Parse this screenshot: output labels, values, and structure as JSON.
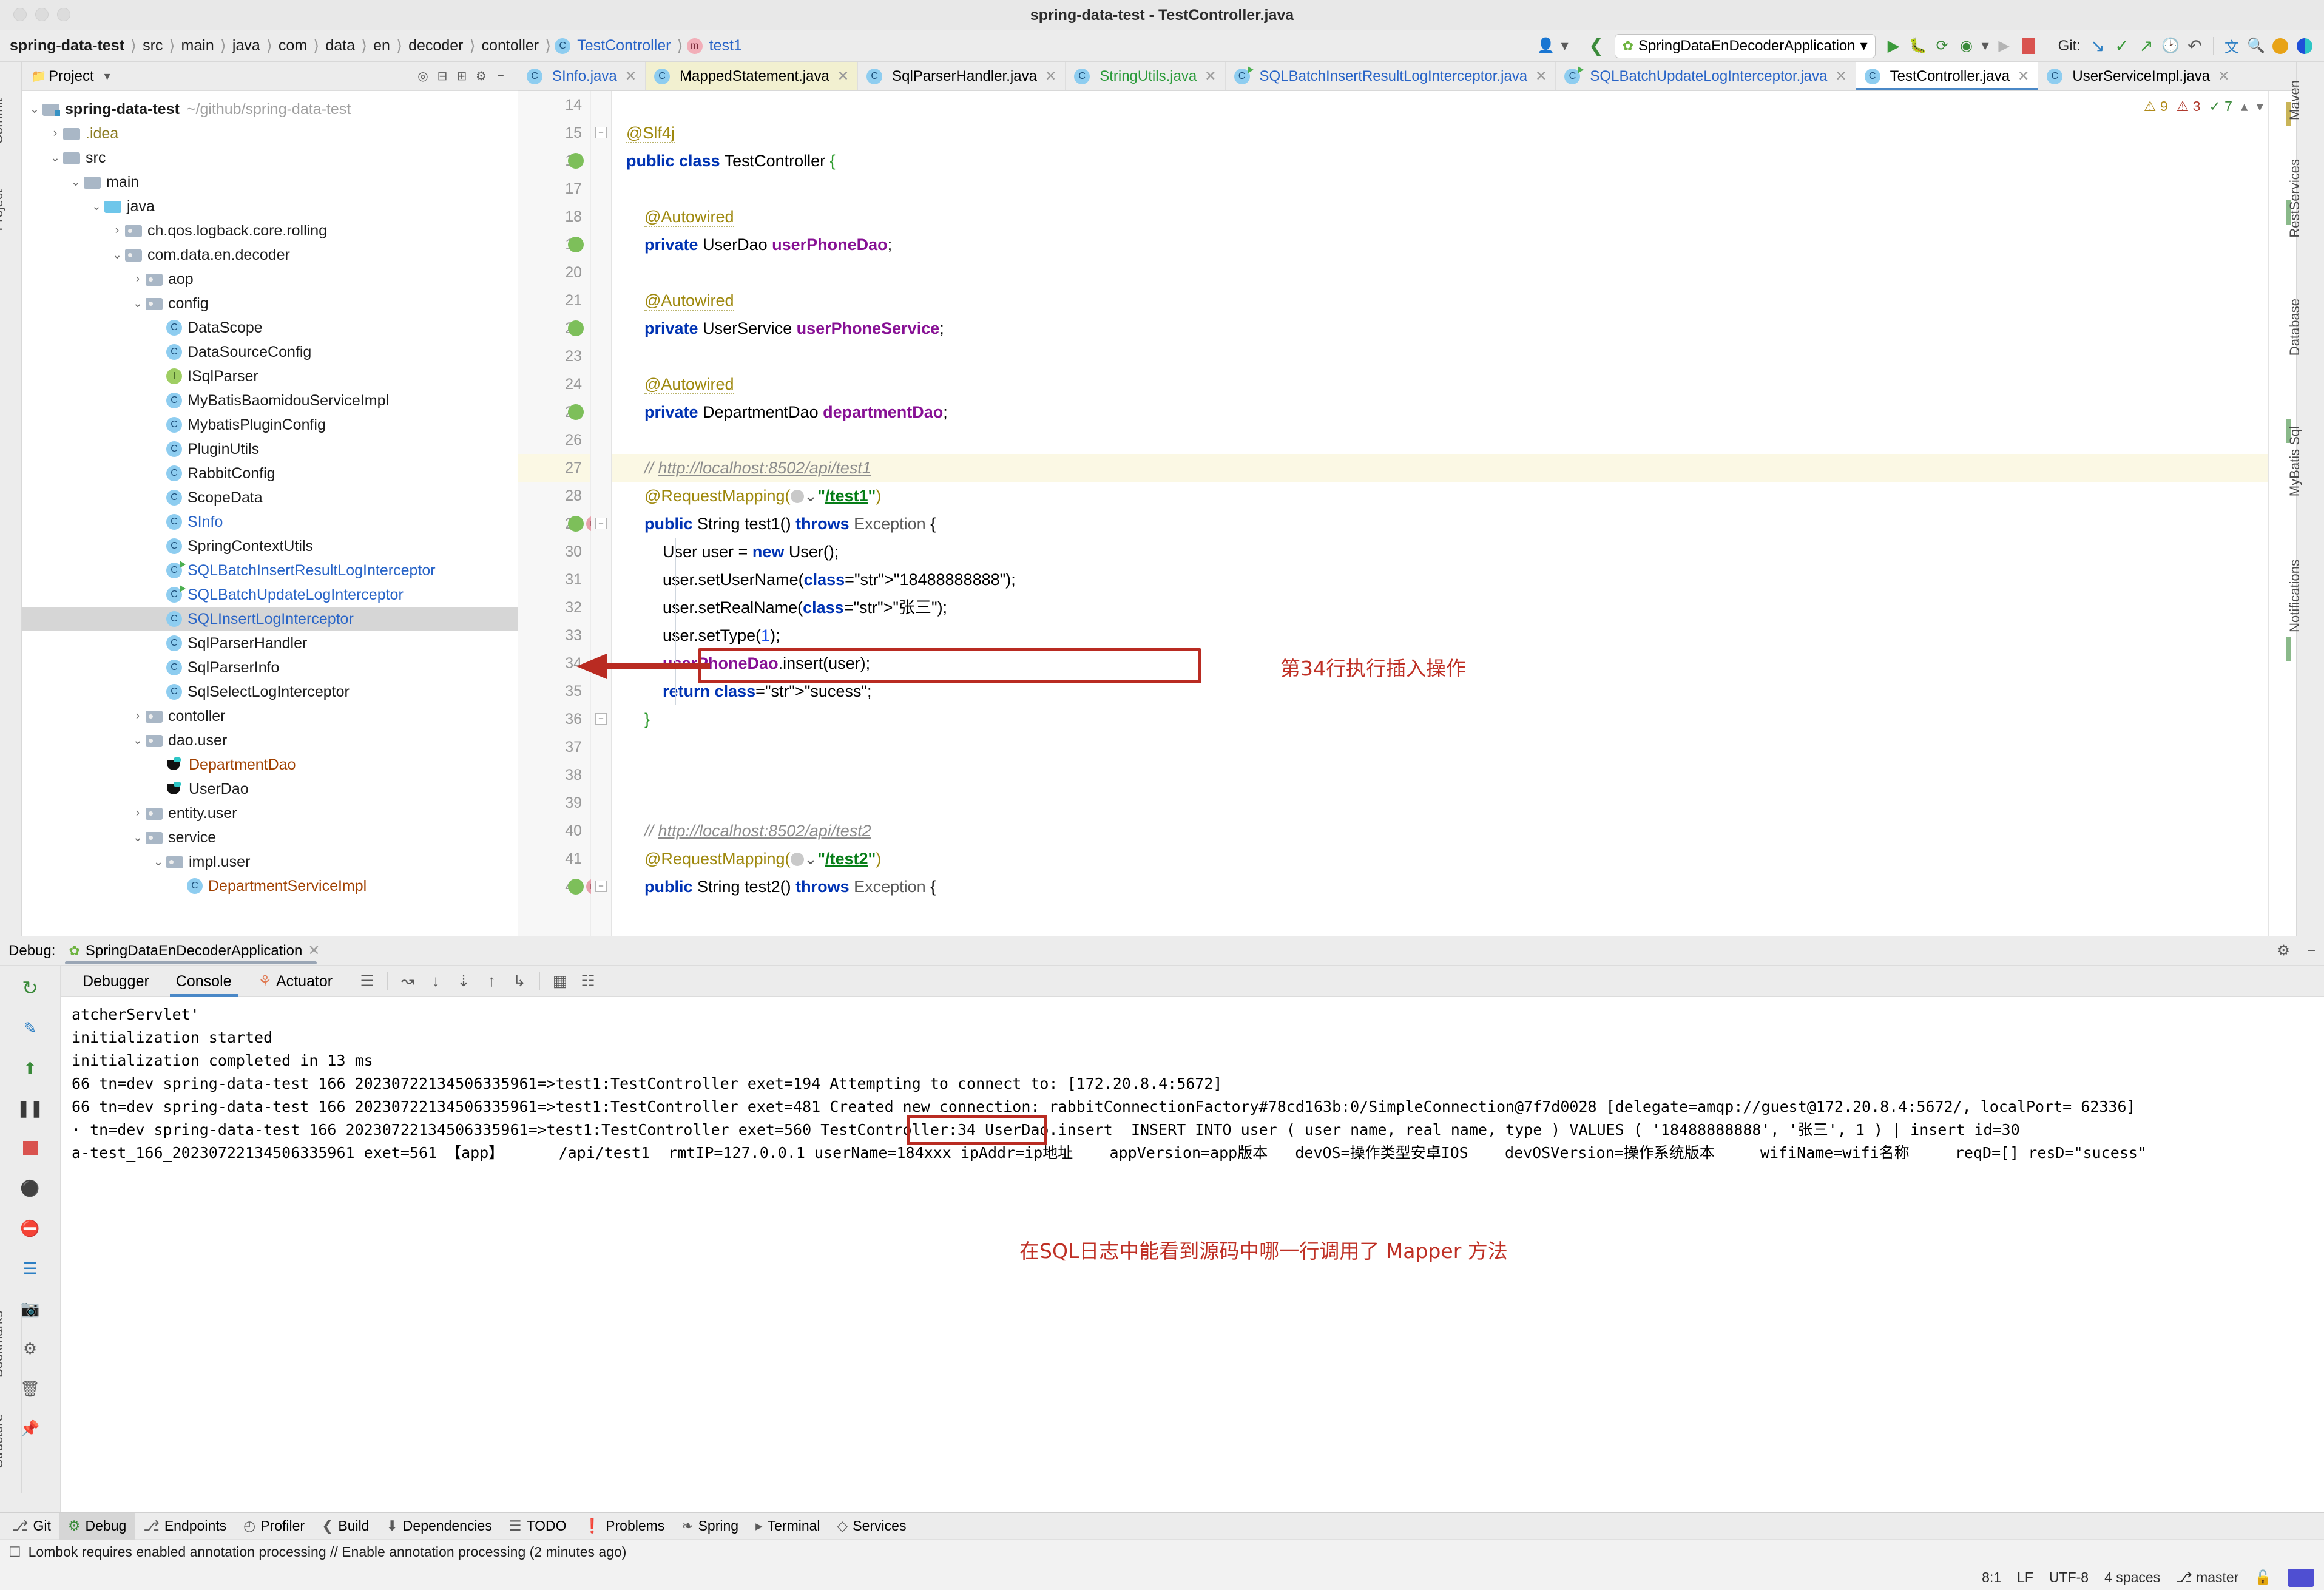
{
  "window": {
    "title": "spring-data-test - TestController.java"
  },
  "breadcrumb": {
    "items": [
      "spring-data-test",
      "src",
      "main",
      "java",
      "com",
      "data",
      "en",
      "decoder",
      "contoller"
    ],
    "class_name": "TestController",
    "method_name": "test1"
  },
  "toolbar": {
    "run_config": "SpringDataEnDecoderApplication",
    "git_label": "Git:",
    "icons": [
      "user-avatar-icon",
      "chevron-down-icon",
      "back-arrow-icon",
      "run-icon",
      "debug-icon",
      "run-with-coverage-icon",
      "profiler-icon",
      "chevron-down-icon",
      "run-disabled-icon",
      "stop-icon",
      "git-update-icon",
      "git-commit-icon",
      "git-push-icon",
      "git-history-icon",
      "git-rollback-icon",
      "translate-icon",
      "search-everywhere-icon",
      "notification-icon",
      "theme-icon"
    ]
  },
  "project_panel": {
    "header": "Project",
    "header_icons": [
      "select-opened-file-icon",
      "collapse-all-icon",
      "expand-icon",
      "settings-gear-icon",
      "hide-icon"
    ],
    "tree": [
      {
        "indent": 0,
        "arrow": "v",
        "icon": "module-folder",
        "label": "spring-data-test",
        "bold": true,
        "path": "~/github/spring-data-test"
      },
      {
        "indent": 1,
        "arrow": ">",
        "icon": "folder",
        "label": ".idea",
        "color": "olive"
      },
      {
        "indent": 1,
        "arrow": "v",
        "icon": "folder",
        "label": "src"
      },
      {
        "indent": 2,
        "arrow": "v",
        "icon": "folder",
        "label": "main"
      },
      {
        "indent": 3,
        "arrow": "v",
        "icon": "folder-blue",
        "label": "java"
      },
      {
        "indent": 4,
        "arrow": ">",
        "icon": "package",
        "label": "ch.qos.logback.core.rolling"
      },
      {
        "indent": 4,
        "arrow": "v",
        "icon": "package",
        "label": "com.data.en.decoder"
      },
      {
        "indent": 5,
        "arrow": ">",
        "icon": "package",
        "label": "aop"
      },
      {
        "indent": 5,
        "arrow": "v",
        "icon": "package",
        "label": "config"
      },
      {
        "indent": 6,
        "arrow": "",
        "icon": "class",
        "label": "DataScope"
      },
      {
        "indent": 6,
        "arrow": "",
        "icon": "class",
        "label": "DataSourceConfig"
      },
      {
        "indent": 6,
        "arrow": "",
        "icon": "interface",
        "label": "ISqlParser"
      },
      {
        "indent": 6,
        "arrow": "",
        "icon": "class",
        "label": "MyBatisBaomidouServiceImpl"
      },
      {
        "indent": 6,
        "arrow": "",
        "icon": "class",
        "label": "MybatisPluginConfig"
      },
      {
        "indent": 6,
        "arrow": "",
        "icon": "class",
        "label": "PluginUtils"
      },
      {
        "indent": 6,
        "arrow": "",
        "icon": "class",
        "label": "RabbitConfig"
      },
      {
        "indent": 6,
        "arrow": "",
        "icon": "class",
        "label": "ScopeData"
      },
      {
        "indent": 6,
        "arrow": "",
        "icon": "class",
        "label": "SInfo",
        "color": "blue"
      },
      {
        "indent": 6,
        "arrow": "",
        "icon": "class",
        "label": "SpringContextUtils"
      },
      {
        "indent": 6,
        "arrow": "",
        "icon": "class-runnable",
        "label": "SQLBatchInsertResultLogInterceptor",
        "color": "blue"
      },
      {
        "indent": 6,
        "arrow": "",
        "icon": "class-runnable",
        "label": "SQLBatchUpdateLogInterceptor",
        "color": "blue"
      },
      {
        "indent": 6,
        "arrow": "",
        "icon": "class",
        "label": "SQLInsertLogInterceptor",
        "color": "blue",
        "selected": true
      },
      {
        "indent": 6,
        "arrow": "",
        "icon": "class",
        "label": "SqlParserHandler"
      },
      {
        "indent": 6,
        "arrow": "",
        "icon": "class",
        "label": "SqlParserInfo"
      },
      {
        "indent": 6,
        "arrow": "",
        "icon": "class",
        "label": "SqlSelectLogInterceptor"
      },
      {
        "indent": 5,
        "arrow": ">",
        "icon": "package",
        "label": "contoller"
      },
      {
        "indent": 5,
        "arrow": "v",
        "icon": "package",
        "label": "dao.user"
      },
      {
        "indent": 6,
        "arrow": "",
        "icon": "mybatis",
        "label": "DepartmentDao",
        "color": "brown"
      },
      {
        "indent": 6,
        "arrow": "",
        "icon": "mybatis",
        "label": "UserDao"
      },
      {
        "indent": 5,
        "arrow": ">",
        "icon": "package",
        "label": "entity.user"
      },
      {
        "indent": 5,
        "arrow": "v",
        "icon": "package",
        "label": "service"
      },
      {
        "indent": 6,
        "arrow": "v",
        "icon": "package",
        "label": "impl.user"
      },
      {
        "indent": 7,
        "arrow": "",
        "icon": "class",
        "label": "DepartmentServiceImpl",
        "color": "brown"
      }
    ]
  },
  "editor": {
    "tabs": [
      {
        "label": "SInfo.java",
        "icon": "class-icon",
        "color": "blue"
      },
      {
        "label": "MappedStatement.java",
        "icon": "class-icon",
        "color": "black",
        "highlighted": true
      },
      {
        "label": "SqlParserHandler.java",
        "icon": "class-icon",
        "color": "black"
      },
      {
        "label": "StringUtils.java",
        "icon": "class-icon",
        "color": "green"
      },
      {
        "label": "SQLBatchInsertResultLogInterceptor.java",
        "icon": "class-runnable-icon",
        "color": "blue"
      },
      {
        "label": "SQLBatchUpdateLogInterceptor.java",
        "icon": "class-runnable-icon",
        "color": "blue"
      },
      {
        "label": "TestController.java",
        "icon": "class-icon",
        "color": "black",
        "active": true
      },
      {
        "label": "UserServiceImpl.java",
        "icon": "class-icon",
        "color": "black"
      }
    ],
    "inspection": {
      "warnings": "9",
      "errors": "3",
      "weak": "7"
    },
    "first_line_number": 14,
    "lines": [
      {
        "n": 14,
        "text": ""
      },
      {
        "n": 15,
        "text": "@Slf4j"
      },
      {
        "n": 16,
        "text": "public class TestController {"
      },
      {
        "n": 17,
        "text": ""
      },
      {
        "n": 18,
        "text": "    @Autowired"
      },
      {
        "n": 19,
        "text": "    private UserDao userPhoneDao;"
      },
      {
        "n": 20,
        "text": ""
      },
      {
        "n": 21,
        "text": "    @Autowired"
      },
      {
        "n": 22,
        "text": "    private UserService userPhoneService;"
      },
      {
        "n": 23,
        "text": ""
      },
      {
        "n": 24,
        "text": "    @Autowired"
      },
      {
        "n": 25,
        "text": "    private DepartmentDao departmentDao;"
      },
      {
        "n": 26,
        "text": ""
      },
      {
        "n": 27,
        "text": "    // http://localhost:8502/api/test1"
      },
      {
        "n": 28,
        "text": "    @RequestMapping(\"/test1\")"
      },
      {
        "n": 29,
        "text": "    public String test1() throws Exception {"
      },
      {
        "n": 30,
        "text": "        User user = new User();"
      },
      {
        "n": 31,
        "text": "        user.setUserName(\"18488888888\");"
      },
      {
        "n": 32,
        "text": "        user.setRealName(\"张三\");"
      },
      {
        "n": 33,
        "text": "        user.setType(1);"
      },
      {
        "n": 34,
        "text": "        userPhoneDao.insert(user);"
      },
      {
        "n": 35,
        "text": "        return \"sucess\";"
      },
      {
        "n": 36,
        "text": "    }"
      },
      {
        "n": 37,
        "text": ""
      },
      {
        "n": 38,
        "text": ""
      },
      {
        "n": 39,
        "text": ""
      },
      {
        "n": 40,
        "text": "    // http://localhost:8502/api/test2"
      },
      {
        "n": 41,
        "text": "    @RequestMapping(\"/test2\")"
      },
      {
        "n": 42,
        "text": "    public String test2() throws Exception {"
      }
    ]
  },
  "annotations": {
    "code_note": "第34行执行插入操作",
    "log_note": "在SQL日志中能看到源码中哪一行调用了 Mapper 方法",
    "accent_color": "#bf3025"
  },
  "debug": {
    "label": "Debug:",
    "session": "SpringDataEnDecoderApplication",
    "tabs": [
      {
        "label": "Debugger"
      },
      {
        "label": "Console",
        "active": true
      },
      {
        "label": "Actuator",
        "icon": "actuator-icon"
      }
    ],
    "side_icons": [
      "rerun-icon",
      "edit-icon",
      "resume-icon",
      "pause-icon",
      "stop-icon",
      "mute-breakpoints-icon",
      "view-breakpoints-icon",
      "settings-icon",
      "camera-icon",
      "print-icon",
      "trash-icon",
      "pin-icon"
    ],
    "toolbar_icons": [
      "soft-wrap-icon",
      "step-over-icon",
      "step-into-icon",
      "force-step-into-icon",
      "step-out-icon",
      "run-to-cursor-icon",
      "evaluate-icon",
      "layout-icon"
    ],
    "console_lines": [
      "atcherServlet'",
      "initialization started",
      "initialization completed in 13 ms",
      "66 tn=dev_spring-data-test_166_20230722134506335961=>test1:TestController exet=194 Attempting to connect to: [172.20.8.4:5672]",
      "66 tn=dev_spring-data-test_166_20230722134506335961=>test1:TestController exet=481 Created new connection: rabbitConnectionFactory#78cd163b:0/SimpleConnection@7f7d0028 [delegate=amqp://guest@172.20.8.4:5672/, localPort= 62336]",
      "· tn=dev_spring-data-test_166_20230722134506335961=>test1:TestController exet=560 TestController:34 UserDao.insert  INSERT INTO user ( user_name, real_name, type ) VALUES ( '18488888888', '张三', 1 ) | insert_id=30",
      "a-test_166_20230722134506335961 exet=561 【app】      /api/test1  rmtIP=127.0.0.1 userName=184xxx ipAddr=ip地址    appVersion=app版本   devOS=操作类型安卓IOS    devOSVersion=操作系统版本     wifiName=wifi名称     reqD=[] resD=\"sucess\""
    ],
    "highlighted_token": "TestController:34"
  },
  "tool_window_bar": {
    "items": [
      {
        "label": "Git",
        "icon": "git-icon"
      },
      {
        "label": "Debug",
        "icon": "debug-icon",
        "active": true
      },
      {
        "label": "Endpoints",
        "icon": "endpoints-icon"
      },
      {
        "label": "Profiler",
        "icon": "profiler-icon"
      },
      {
        "label": "Build",
        "icon": "build-icon"
      },
      {
        "label": "Dependencies",
        "icon": "dependencies-icon"
      },
      {
        "label": "TODO",
        "icon": "todo-icon"
      },
      {
        "label": "Problems",
        "icon": "problems-icon"
      },
      {
        "label": "Spring",
        "icon": "spring-icon"
      },
      {
        "label": "Terminal",
        "icon": "terminal-icon"
      },
      {
        "label": "Services",
        "icon": "services-icon"
      }
    ]
  },
  "message_bar": {
    "text": "Lombok requires enabled annotation processing // Enable annotation processing (2 minutes ago)",
    "icon": "event-log-icon"
  },
  "status_bar": {
    "caret": "8:1",
    "line_separator": "LF",
    "encoding": "UTF-8",
    "indent": "4 spaces",
    "branch": "master",
    "branch_icon": "git-branch-icon",
    "lock_icon": "unlock-icon"
  },
  "left_strip": {
    "labels": [
      "Commit",
      "Project"
    ]
  },
  "right_strip": {
    "labels": [
      "Maven",
      "RestServices",
      "Database",
      "MyBatis Sql",
      "Notifications"
    ]
  },
  "bottom_left_strip": {
    "labels": [
      "Bookmarks",
      "Structure"
    ]
  }
}
